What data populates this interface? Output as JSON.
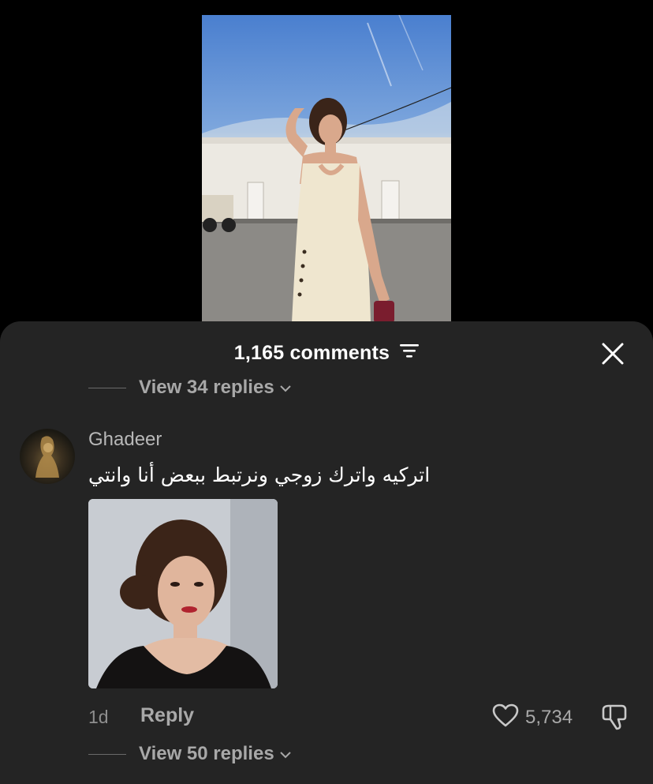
{
  "header": {
    "comment_count": "1,165 comments"
  },
  "thread": {
    "prev_view_replies": "View 34 replies"
  },
  "comment": {
    "username": "Ghadeer",
    "text": "اتركيه واترك زوجي ونرتبط ببعض أنا وانتي",
    "time": "1d",
    "reply_label": "Reply",
    "like_count": "5,734",
    "view_replies": "View 50 replies"
  },
  "icons": {
    "close": "close-icon",
    "filter": "filter-icon",
    "heart": "heart-icon",
    "dislike": "thumbs-down-icon",
    "chevron": "chevron-down-icon"
  },
  "colors": {
    "sheet_bg": "#242424",
    "muted_text": "#a9a9a9",
    "background": "#000000"
  }
}
